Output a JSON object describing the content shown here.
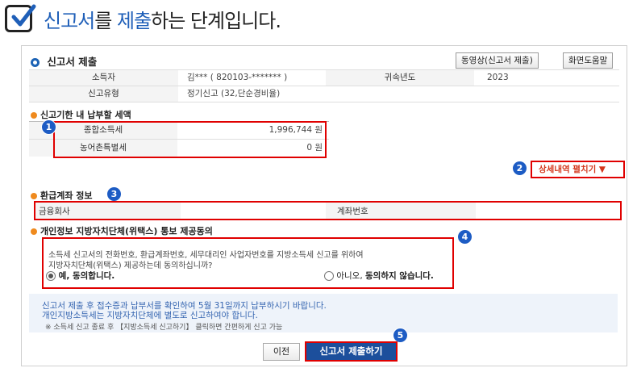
{
  "heading": {
    "part1": "신고서",
    "part2": "를 ",
    "part3": "제출",
    "part4": "하는 단계입니다."
  },
  "section1": {
    "title": "신고서 제출",
    "btn_video": "동영상(신고서 제출)",
    "btn_help": "화면도움말",
    "rows": {
      "taxpayer_label": "소득자",
      "taxpayer_value": "김*** (  820103-******* )",
      "year_label": "귀속년도",
      "year_value": "2023",
      "type_label": "신고유형",
      "type_value": "정기신고 (32,단순경비율)"
    }
  },
  "section2": {
    "title": "신고기한 내 납부할 세액",
    "rows": [
      {
        "label": "종합소득세",
        "value": "1,996,744 원"
      },
      {
        "label": "농어촌특별세",
        "value": "0 원"
      }
    ],
    "detail_btn": "상세내역 펼치기 ▼"
  },
  "section3": {
    "title": "환급계좌 정보",
    "col_bank": "금융회사",
    "col_account": "계좌번호"
  },
  "section4": {
    "title": "개인정보 지방자치단체(위택스) 통보 제공동의",
    "text_line1": "소득세 신고서의 전화번호, 환급계좌번호, 세무대리인 사업자번호를 지방소득세 신고를 위하여",
    "text_line2": "지방자치단체(위택스) 제공하는데 동의하십니까?",
    "option_yes": "예, 동의합니다.",
    "option_no_pre": "아니오, ",
    "option_no_bold": "동의하지 않습니다."
  },
  "notice": {
    "line1": "신고서 제출 후 접수증과 납부서를 확인하여 5월 31일까지 납부하시기 바랍니다.",
    "line2": "개인지방소득세는 지방자치단체에 별도로 신고하여야 합니다.",
    "line3": "※ 소득세 신고 종료 후 【지방소득세 신고하기】 클릭하면 간편하게 신고 가능"
  },
  "buttons": {
    "prev": "이전",
    "submit": "신고서 제출하기"
  },
  "badges": [
    "1",
    "2",
    "3",
    "4",
    "5"
  ],
  "colors": {
    "accent_blue": "#1f5fb8",
    "highlight_red": "#e00000",
    "badge_blue": "#1d5cc4",
    "dot_orange": "#ef8a1e",
    "submit_bg": "#1c4f9c"
  }
}
